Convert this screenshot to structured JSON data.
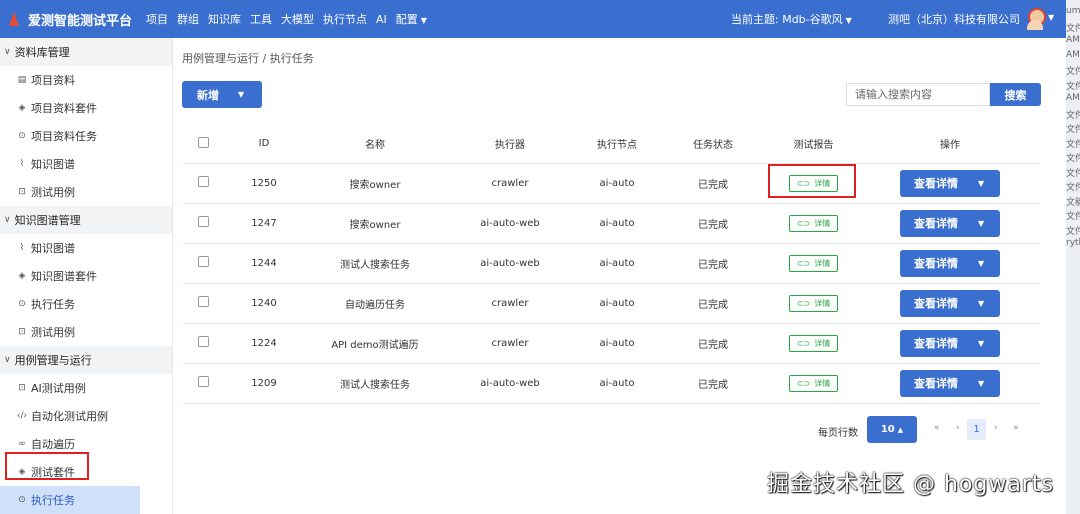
{
  "header": {
    "app_title": "爱测智能测试平台",
    "nav": [
      "项目",
      "群组",
      "知识库",
      "工具",
      "大模型",
      "执行节点",
      "AI"
    ],
    "config_menu": "配置",
    "theme": "当前主题: Mdb-谷歌风",
    "company": "测吧（北京）科技有限公司"
  },
  "sidebar": {
    "groups": [
      {
        "label": "资料库管理",
        "items": [
          {
            "label": "项目资料",
            "icon": "file-icon"
          },
          {
            "label": "项目资料套件",
            "icon": "cube-icon"
          },
          {
            "label": "项目资料任务",
            "icon": "play-circle-icon"
          },
          {
            "label": "知识图谱",
            "icon": "chart-line-icon"
          },
          {
            "label": "测试用例",
            "icon": "robot-icon"
          }
        ]
      },
      {
        "label": "知识图谱管理",
        "items": [
          {
            "label": "知识图谱",
            "icon": "chart-line-icon"
          },
          {
            "label": "知识图谱套件",
            "icon": "cube-icon"
          },
          {
            "label": "执行任务",
            "icon": "play-circle-icon"
          },
          {
            "label": "测试用例",
            "icon": "robot-icon"
          }
        ]
      },
      {
        "label": "用例管理与运行",
        "items": [
          {
            "label": "AI测试用例",
            "icon": "robot-icon"
          },
          {
            "label": "自动化测试用例",
            "icon": "code-icon"
          },
          {
            "label": "自动遍历",
            "icon": "infinity-icon"
          },
          {
            "label": "测试套件",
            "icon": "cube-icon"
          },
          {
            "label": "执行任务",
            "icon": "play-circle-icon",
            "active": true
          }
        ]
      }
    ]
  },
  "main": {
    "breadcrumb": "用例管理与运行  /  执行任务",
    "add_button": "新增",
    "search_placeholder": "请输入搜索内容",
    "search_button": "搜索",
    "columns": [
      "ID",
      "名称",
      "执行器",
      "执行节点",
      "任务状态",
      "测试报告",
      "操作"
    ],
    "rows": [
      {
        "id": "1250",
        "name": "搜索owner",
        "executor": "crawler",
        "node": "ai-auto",
        "status": "已完成"
      },
      {
        "id": "1247",
        "name": "搜索owner",
        "executor": "ai-auto-web",
        "node": "ai-auto",
        "status": "已完成"
      },
      {
        "id": "1244",
        "name": "测试人搜索任务",
        "executor": "ai-auto-web",
        "node": "ai-auto",
        "status": "已完成"
      },
      {
        "id": "1240",
        "name": "自动遍历任务",
        "executor": "crawler",
        "node": "ai-auto",
        "status": "已完成"
      },
      {
        "id": "1224",
        "name": "API demo测试遍历",
        "executor": "crawler",
        "node": "ai-auto",
        "status": "已完成"
      },
      {
        "id": "1209",
        "name": "测试人搜索任务",
        "executor": "ai-auto-web",
        "node": "ai-auto",
        "status": "已完成"
      }
    ],
    "report_label": "详情",
    "op_label": "查看详情",
    "pager": {
      "label": "每页行数",
      "page_size": "10",
      "current_page": "1"
    }
  },
  "watermark": "掘金技术社区 @ hogwarts",
  "bg_strip": [
    "umi",
    "文件",
    "AM",
    "AM",
    "文件",
    "文件",
    "AM",
    "文件",
    "文件",
    "文件",
    "文件",
    "文件",
    "文件",
    "文稿",
    "文件",
    "文件",
    "ryth"
  ],
  "colors": {
    "primary": "#3b6fcf",
    "success": "#27a745",
    "highlight": "#e02020"
  }
}
